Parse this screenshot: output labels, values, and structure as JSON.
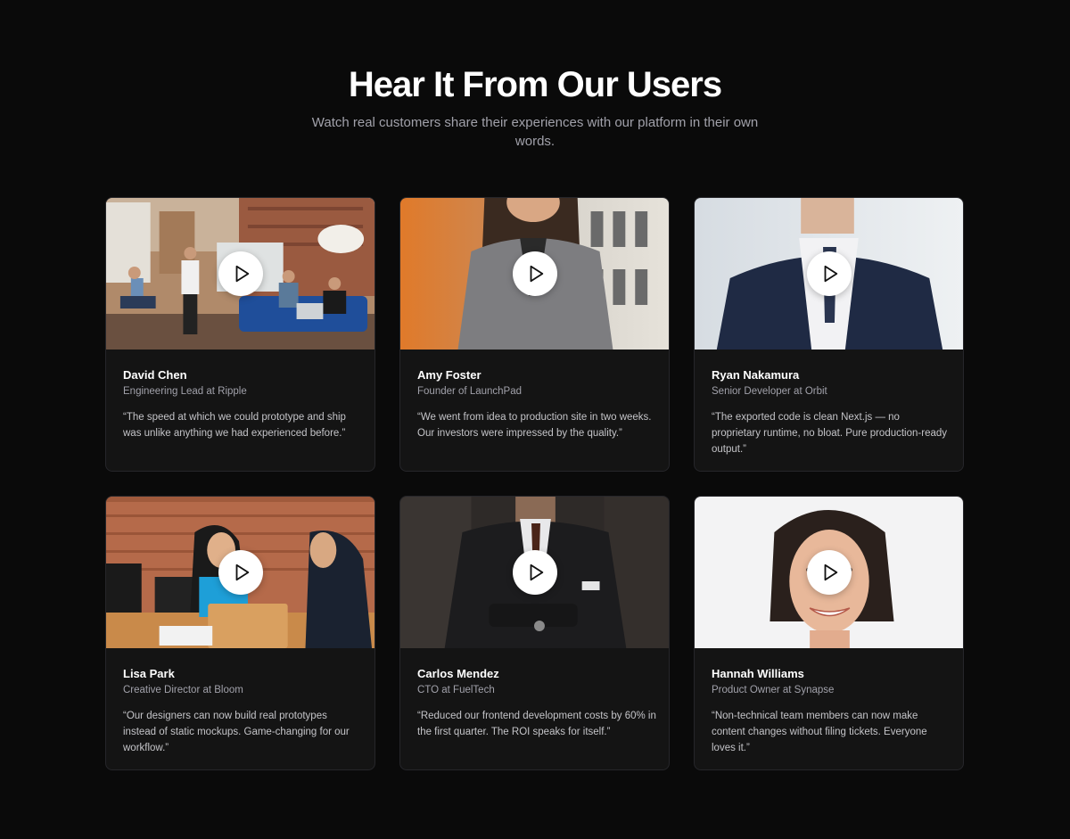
{
  "header": {
    "title": "Hear It From Our Users",
    "subtitle": "Watch real customers share their experiences with our platform in their own words."
  },
  "testimonials": [
    {
      "name": "David Chen",
      "role": "Engineering Lead at Ripple",
      "quote": "“The speed at which we could prototype and ship was unlike anything we had experienced before.”"
    },
    {
      "name": "Amy Foster",
      "role": "Founder of LaunchPad",
      "quote": "“We went from idea to production site in two weeks. Our investors were impressed by the quality.”"
    },
    {
      "name": "Ryan Nakamura",
      "role": "Senior Developer at Orbit",
      "quote": "“The exported code is clean Next.js — no proprietary runtime, no bloat. Pure production-ready output.”"
    },
    {
      "name": "Lisa Park",
      "role": "Creative Director at Bloom",
      "quote": "“Our designers can now build real prototypes instead of static mockups. Game-changing for our workflow.”"
    },
    {
      "name": "Carlos Mendez",
      "role": "CTO at FuelTech",
      "quote": "“Reduced our frontend development costs by 60% in the first quarter. The ROI speaks for itself.”"
    },
    {
      "name": "Hannah Williams",
      "role": "Product Owner at Synapse",
      "quote": "“Non-technical team members can now make content changes without filing tickets. Everyone loves it.”"
    }
  ],
  "colors": {
    "background": "#0a0a0a",
    "card": "#141414",
    "card_border": "#26262a",
    "muted_text": "#a1a1aa",
    "play_button": "#ffffff"
  },
  "icons": {
    "play": "play-icon"
  }
}
